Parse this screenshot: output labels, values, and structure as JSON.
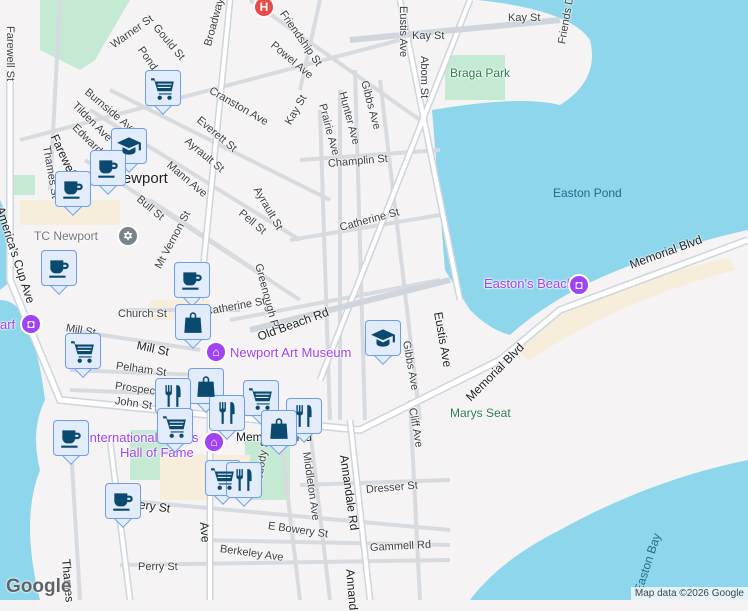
{
  "map": {
    "labels": {
      "farewell_st_n": "Farewell St",
      "warner_st": "Warner St",
      "gould_st": "Gould St",
      "pond_ave": "Pond Ave",
      "broadway": "Broadway",
      "friendship_st": "Friendship St",
      "powel_ave": "Powel Ave",
      "kay_st_ne": "Kay St",
      "kay_st_far": "Kay St",
      "friends_dr": "Friends Dr",
      "eustis_ave_n": "Eustis Ave",
      "abom_st": "Abom St",
      "gibbs_ave_n": "Gibbs Ave",
      "hunter_ave": "Hunter Ave",
      "prairie_ave": "Prairie Ave",
      "kay_st": "Kay St",
      "cranston_ave": "Cranston Ave",
      "burnside_ave": "Burnside Ave",
      "tilden_ave": "Tilden Ave",
      "edward": "Edward",
      "everett_st": "Everett St",
      "ayrault_st": "Ayrault St",
      "farewell_st": "Farewell St",
      "thames_st_n": "Thames St",
      "mann_ave": "Mann Ave",
      "champlin_st": "Champlin St",
      "bull_st": "Bull St",
      "ayrault_st_2": "Ayrault St",
      "pell_st": "Pell St",
      "catherine_st_e": "Catherine St",
      "mt_vernon_st": "Mt Vernon St",
      "americas_cup_ave": "America's Cup Ave",
      "memorial_blvd_e": "Memorial Blvd",
      "greenough_pl": "Greenough Pl",
      "catherine_st": "Catherine St",
      "old_beach_rd": "Old Beach Rd",
      "church_st": "Church St",
      "mill_st_w": "Mill St",
      "mill_st": "Mill St",
      "pelham_st": "Pelham St",
      "prospect_st": "Prospect St",
      "john_st": "John St",
      "eustis_ave": "Eustis Ave",
      "gibbs_ave": "Gibbs Ave",
      "memorial_blvd_mid": "Memorial Blvd",
      "cliff_ave": "Cliff Ave",
      "memorial_blvd_w": "Memorial Blvd",
      "freebody_st": "Freebody St",
      "middleton_ave": "Middleton Ave",
      "annandale_rd": "Annandale Rd",
      "dresser_st": "Dresser St",
      "bowery_st": "Bowery St",
      "e_bowery_st": "E Bowery St",
      "berkeley_ave": "Berkeley Ave",
      "gammell_rd": "Gammell Rd",
      "perry_st": "Perry St",
      "thames_s": "Thames",
      "annandale_s": "Annand",
      "bellevue_ave": "Ave"
    },
    "places": {
      "newport": "Newport",
      "braga_park": "Braga Park",
      "easton_pond": "Easton Pond",
      "marys_seat": "Marys Seat",
      "easton_bay": "Easton Bay",
      "touro": "TC Newport",
      "eastons_beach": "Easton's Beach",
      "art_museum": "Newport Art Museum",
      "tennis_hof_1": "International Tennis",
      "tennis_hof_2": "Hall of Fame",
      "wharf": "arf"
    },
    "attribution": "Map data ©2026 Google",
    "logo": "Google",
    "colors": {
      "water": "#8ed6ec",
      "park": "#c5ead3",
      "road": "#ffffff",
      "road_edge": "#d4d9df",
      "marker_bg": "#e3ecfb",
      "marker_border": "#6d9eeb",
      "icon": "#0b4a6f",
      "poi": "#a142f4",
      "hospital": "#e94a4a"
    }
  }
}
